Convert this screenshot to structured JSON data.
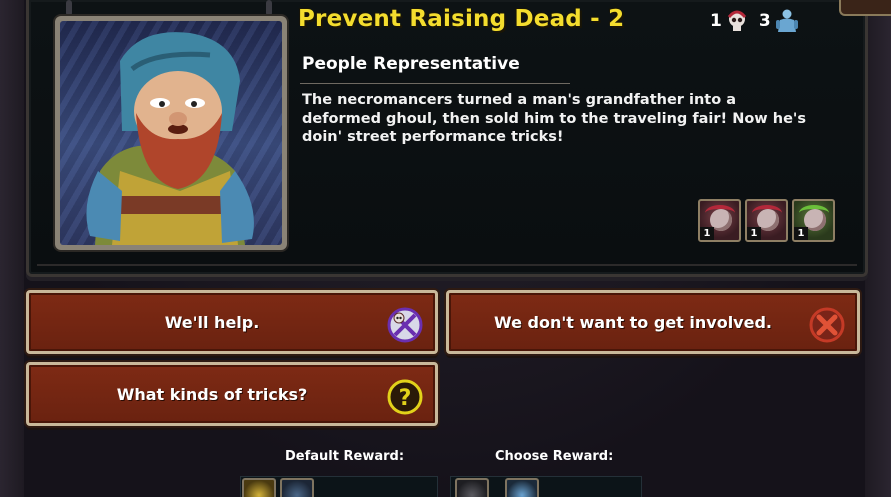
{
  "event": {
    "title": "Prevent Raising Dead - 2",
    "subtitle": "People Representative",
    "description": "The necromancers turned a man's grandfather into a deformed ghoul, then sold him to the traveling fair! Now he's doin' street performance tricks!"
  },
  "counters": {
    "skull": {
      "value": "1",
      "icon": "skull-icon"
    },
    "heroes": {
      "value": "3",
      "icon": "hero-icon"
    }
  },
  "units": [
    {
      "qty": "1",
      "icon": "red-demon-unit-icon"
    },
    {
      "qty": "1",
      "icon": "red-demon-unit-icon"
    },
    {
      "qty": "1",
      "icon": "green-demon-unit-icon"
    }
  ],
  "choices": [
    {
      "label": "We'll help.",
      "icon": "crossed-swords-skull-icon"
    },
    {
      "label": "We don't want to get involved.",
      "icon": "red-x-icon"
    },
    {
      "label": "What kinds of tricks?",
      "icon": "question-icon"
    }
  ],
  "rewards": {
    "default_label": "Default Reward:",
    "choose_label": "Choose Reward:"
  },
  "colors": {
    "title": "#f4dd2e",
    "button_bg": "#7e2a14",
    "button_border": "#c9b89a"
  }
}
